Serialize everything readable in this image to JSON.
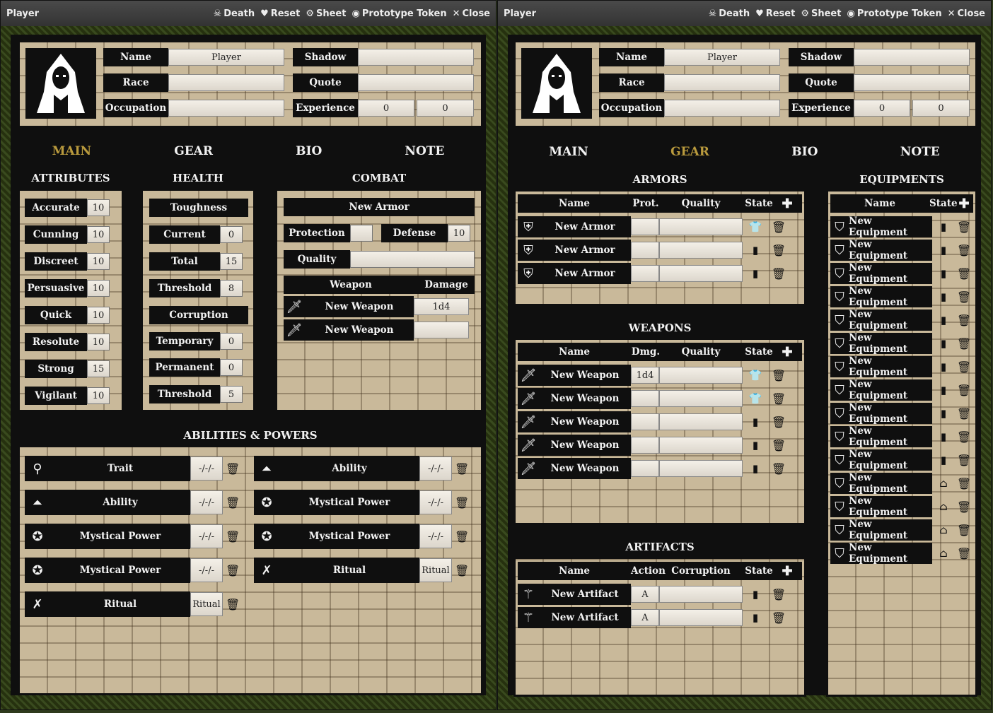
{
  "windows": [
    {
      "title": "Player",
      "actions": [
        {
          "icon": "skull-icon",
          "label": "Death"
        },
        {
          "icon": "heart-icon",
          "label": "Reset"
        },
        {
          "icon": "gear-icon",
          "label": "Sheet"
        },
        {
          "icon": "user-icon",
          "label": "Prototype Token"
        },
        {
          "icon": "close-icon",
          "label": "Close"
        }
      ],
      "header": {
        "name_label": "Name",
        "name_value": "Player",
        "race_label": "Race",
        "race_value": "",
        "occupation_label": "Occupation",
        "occupation_value": "",
        "shadow_label": "Shadow",
        "shadow_value": "",
        "quote_label": "Quote",
        "quote_value": "",
        "experience_label": "Experience",
        "experience_value_1": "0",
        "experience_value_2": "0"
      },
      "tabs": [
        "MAIN",
        "GEAR",
        "BIO",
        "NOTE"
      ],
      "active_tab": "MAIN",
      "attributes": {
        "title": "ATTRIBUTES",
        "items": [
          {
            "label": "Accurate",
            "value": "10"
          },
          {
            "label": "Cunning",
            "value": "10"
          },
          {
            "label": "Discreet",
            "value": "10"
          },
          {
            "label": "Persuasive",
            "value": "10"
          },
          {
            "label": "Quick",
            "value": "10"
          },
          {
            "label": "Resolute",
            "value": "10"
          },
          {
            "label": "Strong",
            "value": "15"
          },
          {
            "label": "Vigilant",
            "value": "10"
          }
        ]
      },
      "health": {
        "title": "HEALTH",
        "toughness_label": "Toughness",
        "current_label": "Current",
        "current_value": "0",
        "total_label": "Total",
        "total_value": "15",
        "threshold_label": "Threshold",
        "threshold_value": "8",
        "corruption_label": "Corruption",
        "temporary_label": "Temporary",
        "temporary_value": "0",
        "permanent_label": "Permanent",
        "permanent_value": "0",
        "corruption_threshold_label": "Threshold",
        "corruption_threshold_value": "5"
      },
      "combat": {
        "title": "COMBAT",
        "armor_name": "New Armor",
        "protection_label": "Protection",
        "protection_value": "",
        "defense_label": "Defense",
        "defense_value": "10",
        "quality_label": "Quality",
        "quality_value": "",
        "weapon_header": "Weapon",
        "damage_header": "Damage",
        "weapons": [
          {
            "name": "New Weapon",
            "damage": "1d4"
          },
          {
            "name": "New Weapon",
            "damage": ""
          }
        ]
      },
      "abilities": {
        "title": "ABILITIES & POWERS",
        "items": [
          {
            "icon": "trait-icon",
            "name": "Trait",
            "value": "-/-/-"
          },
          {
            "icon": "ability-icon",
            "name": "Ability",
            "value": "-/-/-"
          },
          {
            "icon": "ability-icon",
            "name": "Ability",
            "value": "-/-/-"
          },
          {
            "icon": "mystical-power-icon",
            "name": "Mystical Power",
            "value": "-/-/-"
          },
          {
            "icon": "mystical-power-icon",
            "name": "Mystical Power",
            "value": "-/-/-"
          },
          {
            "icon": "mystical-power-icon",
            "name": "Mystical Power",
            "value": "-/-/-"
          },
          {
            "icon": "mystical-power-icon",
            "name": "Mystical Power",
            "value": "-/-/-"
          },
          {
            "icon": "ritual-icon",
            "name": "Ritual",
            "value": "Ritual"
          },
          {
            "icon": "ritual-icon",
            "name": "Ritual",
            "value": "Ritual"
          }
        ]
      }
    },
    {
      "title": "Player",
      "actions": [
        {
          "icon": "skull-icon",
          "label": "Death"
        },
        {
          "icon": "heart-icon",
          "label": "Reset"
        },
        {
          "icon": "gear-icon",
          "label": "Sheet"
        },
        {
          "icon": "user-icon",
          "label": "Prototype Token"
        },
        {
          "icon": "close-icon",
          "label": "Close"
        }
      ],
      "header": {
        "name_label": "Name",
        "name_value": "Player",
        "race_label": "Race",
        "race_value": "",
        "occupation_label": "Occupation",
        "occupation_value": "",
        "shadow_label": "Shadow",
        "shadow_value": "",
        "quote_label": "Quote",
        "quote_value": "",
        "experience_label": "Experience",
        "experience_value_1": "0",
        "experience_value_2": "0"
      },
      "tabs": [
        "MAIN",
        "GEAR",
        "BIO",
        "NOTE"
      ],
      "active_tab": "GEAR",
      "armors": {
        "title": "ARMORS",
        "columns": [
          "Name",
          "Prot.",
          "Quality",
          "State"
        ],
        "rows": [
          {
            "name": "New Armor",
            "prot": "",
            "quality": ""
          },
          {
            "name": "New Armor",
            "prot": "",
            "quality": ""
          },
          {
            "name": "New Armor",
            "prot": "",
            "quality": ""
          }
        ]
      },
      "weapons": {
        "title": "WEAPONS",
        "columns": [
          "Name",
          "Dmg.",
          "Quality",
          "State"
        ],
        "rows": [
          {
            "name": "New Weapon",
            "dmg": "1d4",
            "quality": ""
          },
          {
            "name": "New Weapon",
            "dmg": "",
            "quality": ""
          },
          {
            "name": "New Weapon",
            "dmg": "",
            "quality": ""
          },
          {
            "name": "New Weapon",
            "dmg": "",
            "quality": ""
          },
          {
            "name": "New Weapon",
            "dmg": "",
            "quality": ""
          }
        ]
      },
      "artifacts": {
        "title": "ARTIFACTS",
        "columns": [
          "Name",
          "Action",
          "Corruption",
          "State"
        ],
        "rows": [
          {
            "name": "New Artifact",
            "action": "A",
            "corruption": ""
          },
          {
            "name": "New Artifact",
            "action": "A",
            "corruption": ""
          }
        ]
      },
      "equipments": {
        "title": "EQUIPMENTS",
        "columns": [
          "Name",
          "State"
        ],
        "rows": [
          "New Equipment",
          "New Equipment",
          "New Equipment",
          "New Equipment",
          "New Equipment",
          "New Equipment",
          "New Equipment",
          "New Equipment",
          "New Equipment",
          "New Equipment",
          "New Equipment",
          "New Equipment",
          "New Equipment",
          "New Equipment",
          "New Equipment"
        ]
      }
    }
  ]
}
